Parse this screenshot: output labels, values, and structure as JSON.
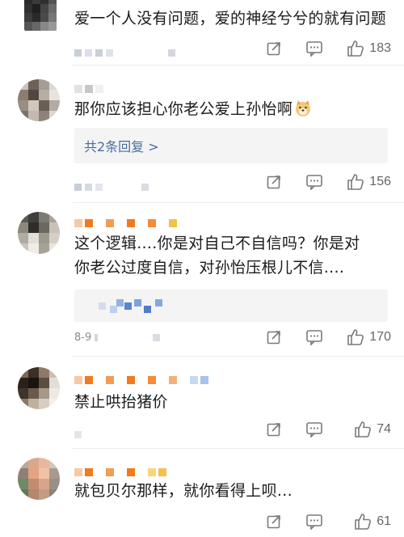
{
  "comments": [
    {
      "text": "爱一个人没有问题，爱的神经兮兮的就有问题",
      "likes": "183",
      "has_reply_box": false
    },
    {
      "text": "那你应该担心你老公爱上孙怡啊",
      "emoji": "doge",
      "likes": "156",
      "reply_label": "共2条回复 >"
    },
    {
      "text": "这个逻辑....你是对自己不自信吗？你是对你老公过度自信，对孙怡压根儿不信....",
      "likes": "170",
      "timestamp": "8-9"
    },
    {
      "text": "禁止哄抬猪价",
      "likes": "74"
    },
    {
      "text": "就包贝尔那样，就你看得上呗...",
      "likes": "61"
    }
  ],
  "icons": {
    "share": "share-icon",
    "comment": "comment-icon",
    "like": "thumbs-up-icon"
  },
  "colors": {
    "reply_link": "#4a6d9b",
    "icon": "#7a7a7a",
    "username_orange": "#f07b1f"
  }
}
